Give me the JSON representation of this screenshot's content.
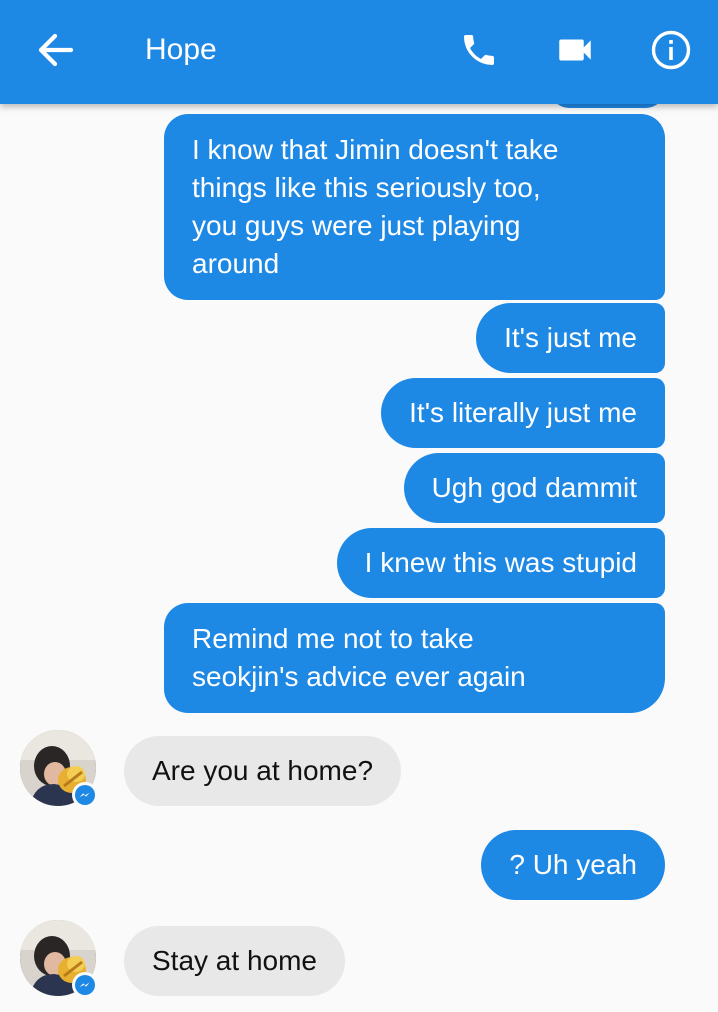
{
  "header": {
    "title": "Hope",
    "back_icon": "arrow-left-icon",
    "call_icon": "phone-icon",
    "video_icon": "video-camera-icon",
    "info_icon": "info-icon",
    "color": "#1e88e5"
  },
  "messages": [
    {
      "from": "me",
      "text_lines": [
        "I know that Jimin doesn't take",
        "things like this seriously too,",
        "you guys were just playing",
        "around"
      ]
    },
    {
      "from": "me",
      "text": "It's just me"
    },
    {
      "from": "me",
      "text": "It's literally just me"
    },
    {
      "from": "me",
      "text": "Ugh god dammit"
    },
    {
      "from": "me",
      "text": "I knew this was stupid"
    },
    {
      "from": "me",
      "text_lines": [
        "Remind me not to take",
        "seokjin's advice ever again"
      ]
    },
    {
      "from": "Hope",
      "text": "Are you at home?"
    },
    {
      "from": "me",
      "text": "? Uh yeah"
    },
    {
      "from": "Hope",
      "text": "Stay at home"
    }
  ],
  "colors": {
    "outgoing_bubble": "#1e88e5",
    "incoming_bubble": "#e8e8e8",
    "background": "#fafafa",
    "messenger_badge": "#1e88e5"
  }
}
